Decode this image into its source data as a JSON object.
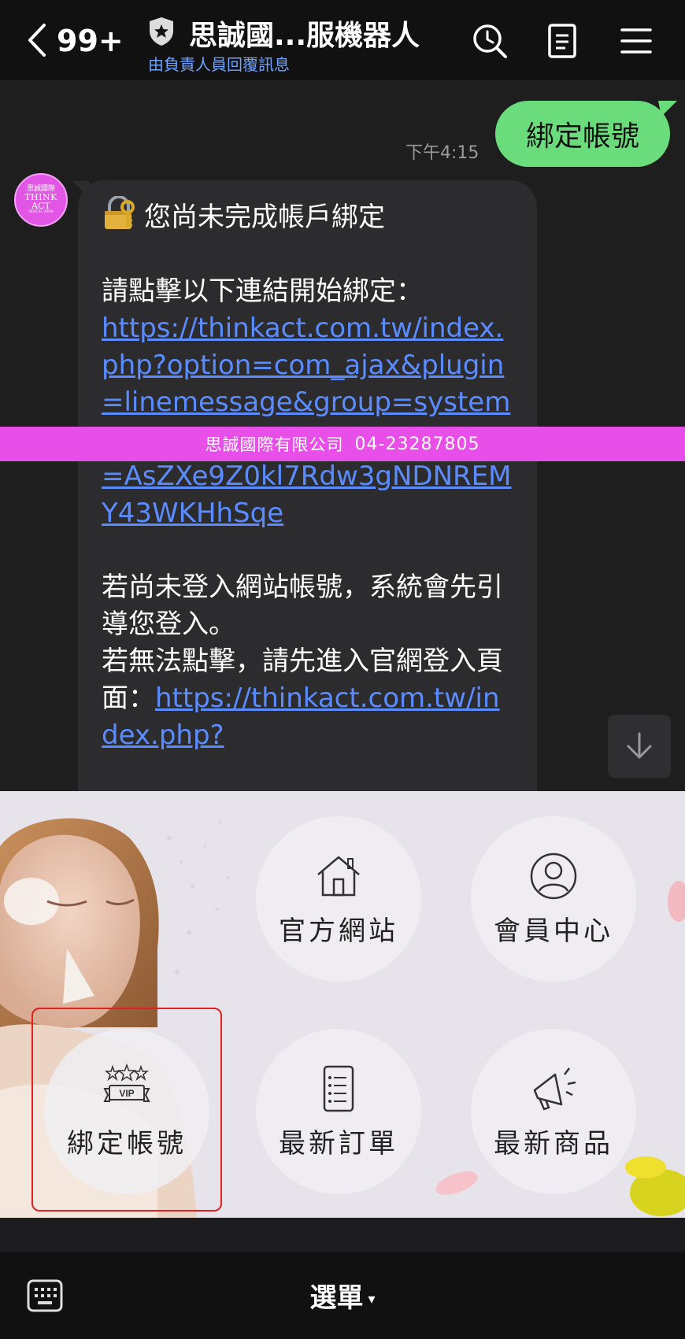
{
  "header": {
    "unread_count": "99+",
    "title": "思誠國...服機器人",
    "subtitle": "由負責人員回覆訊息",
    "icons": [
      "back-icon",
      "shield-icon",
      "search-clock-icon",
      "notes-icon",
      "menu-icon"
    ]
  },
  "chat": {
    "sent_message": "綁定帳號",
    "sent_time": "下午4:15",
    "avatar": {
      "line1": "思誠國際",
      "line2": "THINK",
      "line3": "ACT",
      "line4": "SINCE 2008"
    },
    "received": {
      "heading": "您尚未完成帳戶綁定",
      "prompt": "請點擊以下連結開始綁定：",
      "link1": "https://thinkact.com.tw/index.php?option=com_ajax&plugin=linemessage&group=system&method=linkstart&linkToken=AsZXe9Z0kl7Rdw3gNDNREMY43WKHhSqe",
      "note1": "若尚未登入網站帳號，系統會先引導您登入。",
      "note2_prefix": "若無法點擊，請先進入官網登入頁面：",
      "link2": "https://thinkact.com.tw/index.php?"
    }
  },
  "rich_menu": {
    "items": [
      {
        "label": "官方網站",
        "icon": "house-icon"
      },
      {
        "label": "會員中心",
        "icon": "user-icon"
      },
      {
        "label": "綁定帳號",
        "icon": "vip-icon"
      },
      {
        "label": "最新訂單",
        "icon": "order-list-icon"
      },
      {
        "label": "最新商品",
        "icon": "megaphone-icon"
      }
    ],
    "company": "思誠國際有限公司",
    "phone": "04-23287805",
    "brand_color": "#e84ee8"
  },
  "bottom_bar": {
    "menu_label": "選單",
    "caret": "▾"
  },
  "colors": {
    "sent_bubble": "#6bdc7c",
    "link": "#5b8cff",
    "highlight": "#e32020"
  }
}
